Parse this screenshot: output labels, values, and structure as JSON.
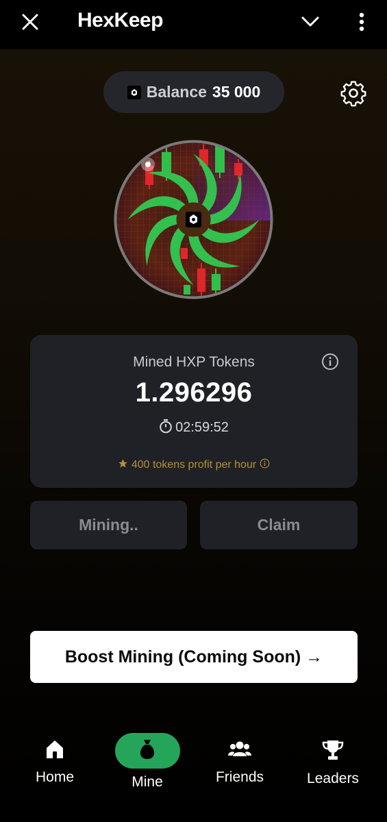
{
  "app": {
    "title": "HexKeep"
  },
  "balance": {
    "label": "Balance",
    "value": "35 000"
  },
  "card": {
    "title": "Mined HXP Tokens",
    "mined_value": "1.296296",
    "timer": "02:59:52",
    "profit_text": "400 tokens profit per hour"
  },
  "actions": {
    "mining_label": "Mining..",
    "claim_label": "Claim"
  },
  "boost": {
    "label": "Boost Mining (Coming Soon) →"
  },
  "nav": {
    "items": [
      {
        "label": "Home",
        "icon": "home-icon"
      },
      {
        "label": "Mine",
        "icon": "money-bag-icon",
        "active": true
      },
      {
        "label": "Friends",
        "icon": "friends-icon"
      },
      {
        "label": "Leaders",
        "icon": "trophy-icon"
      }
    ]
  },
  "colors": {
    "accent_green": "#25a55a",
    "card_bg": "#202126",
    "profit_gold": "#b59034",
    "candle_green": "#2fbf4a",
    "candle_red": "#e0262a"
  }
}
